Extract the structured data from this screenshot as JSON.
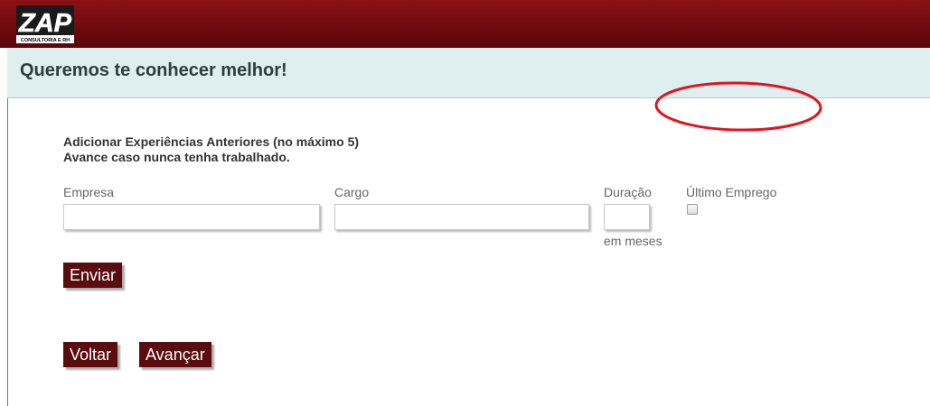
{
  "header": {
    "logo_text": "ZAP",
    "logo_subtext": "CONSULTORIA E RH"
  },
  "page": {
    "title": "Queremos te conhecer melhor!"
  },
  "form": {
    "intro_line1": "Adicionar Experiências Anteriores (no máximo 5)",
    "intro_line2": "Avance caso nunca tenha trabalhado.",
    "company_label": "Empresa",
    "company_value": "",
    "role_label": "Cargo",
    "role_value": "",
    "duration_label": "Duração",
    "duration_value": "",
    "duration_unit": "em meses",
    "last_job_label": "Último Emprego",
    "last_job_checked": false,
    "submit_label": "Enviar"
  },
  "nav": {
    "back_label": "Voltar",
    "next_label": "Avançar"
  },
  "colors": {
    "header_bg": "#6d0a0e",
    "subheader_bg": "#dfeeee",
    "button_bg": "#5a0c0f",
    "highlight": "#e0141e"
  }
}
